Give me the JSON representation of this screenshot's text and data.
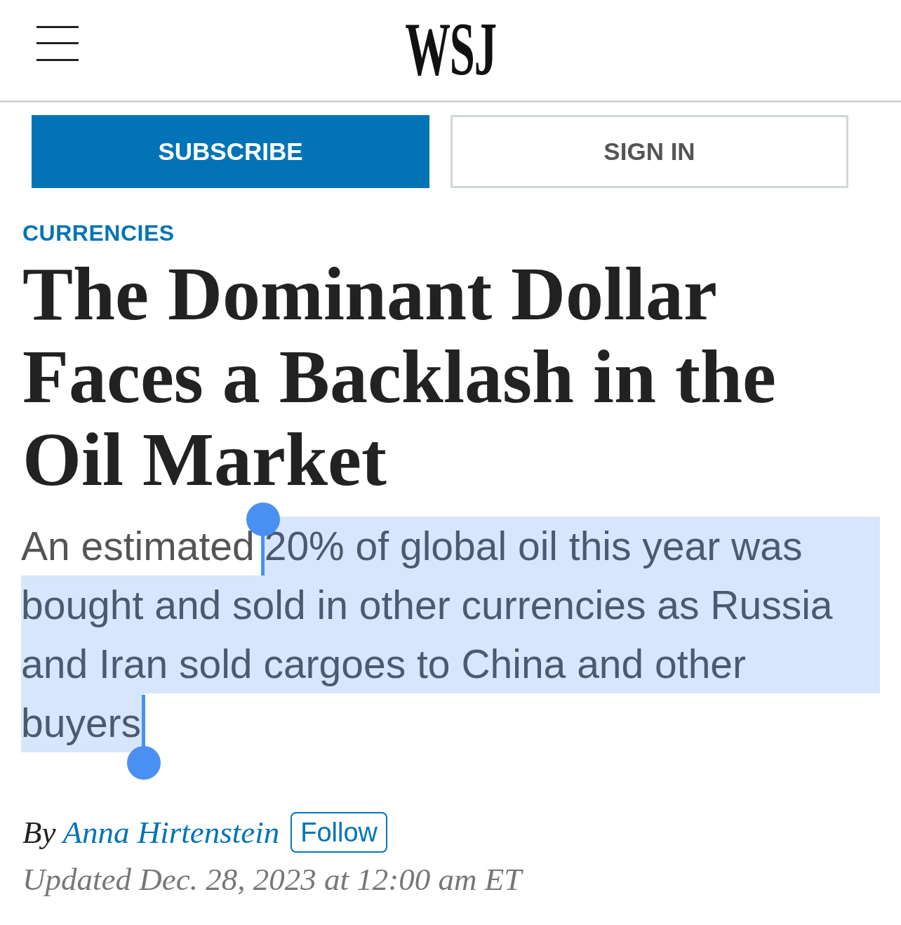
{
  "header": {
    "logo": "WSJ"
  },
  "actions": [
    {
      "label": "SUBSCRIBE",
      "kind": "primary"
    },
    {
      "label": "SIGN IN",
      "kind": "secondary"
    }
  ],
  "article": {
    "section": "CURRENCIES",
    "headline": "The Dominant Dollar Faces a Backlash in the Oil Market",
    "dek": {
      "lines": [
        {
          "parts": [
            {
              "text": "An estimated",
              "selected": false
            },
            {
              "text": "20% of global oil this year was",
              "selected": true
            }
          ]
        },
        {
          "parts": [
            {
              "text": "bought and sold in other currencies as Russia",
              "selected": true
            }
          ]
        },
        {
          "parts": [
            {
              "text": "and Iran sold cargoes to China and other",
              "selected": true
            }
          ]
        },
        {
          "parts": [
            {
              "text": "buyers",
              "selected": true
            }
          ]
        }
      ]
    },
    "byline": {
      "prefix": "By",
      "author": "Anna Hirtenstein",
      "follow": "Follow"
    },
    "timestamp": "Updated Dec. 28, 2023 at 12:00 am ET"
  }
}
